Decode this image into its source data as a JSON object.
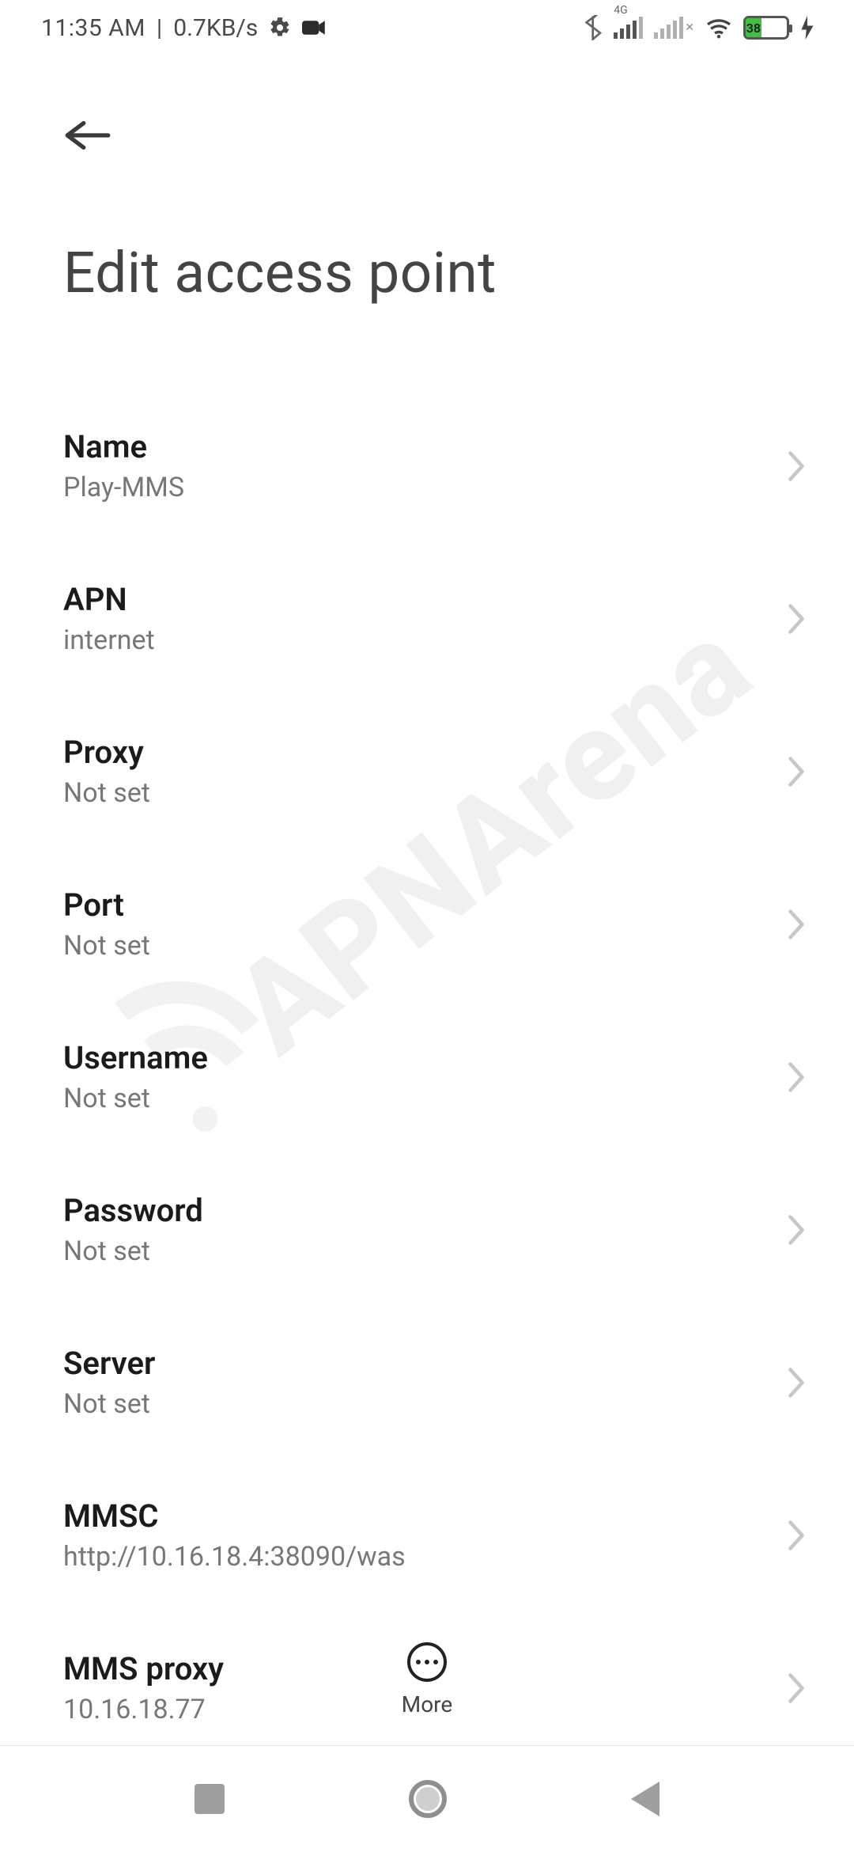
{
  "status_bar": {
    "time": "11:35 AM",
    "separator": "|",
    "net_speed": "0.7KB/s",
    "signal1_label": "4G",
    "battery_percent": "38"
  },
  "header": {
    "title": "Edit access point"
  },
  "rows": [
    {
      "label": "Name",
      "value": "Play-MMS"
    },
    {
      "label": "APN",
      "value": "internet"
    },
    {
      "label": "Proxy",
      "value": "Not set"
    },
    {
      "label": "Port",
      "value": "Not set"
    },
    {
      "label": "Username",
      "value": "Not set"
    },
    {
      "label": "Password",
      "value": "Not set"
    },
    {
      "label": "Server",
      "value": "Not set"
    },
    {
      "label": "MMSC",
      "value": "http://10.16.18.4:38090/was"
    },
    {
      "label": "MMS proxy",
      "value": "10.16.18.77"
    }
  ],
  "footer": {
    "more_label": "More"
  },
  "watermark_text": "APNArena"
}
